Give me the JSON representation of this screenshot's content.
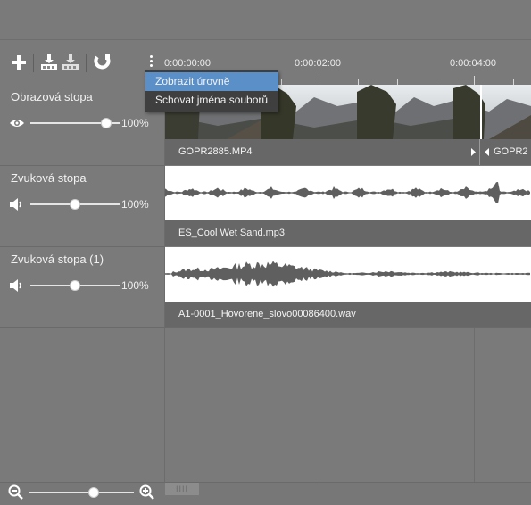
{
  "toolbar": {
    "buttons": [
      {
        "name": "add-track-button",
        "icon": "plus-icon"
      },
      {
        "name": "import-media-button",
        "icon": "import-icon"
      },
      {
        "name": "export-media-button",
        "icon": "export-icon"
      },
      {
        "name": "snap-button",
        "icon": "magnet-icon"
      },
      {
        "name": "more-options-button",
        "icon": "kebab-icon"
      }
    ]
  },
  "ruler": {
    "labels": [
      "0:00:00:00",
      "0:00:02:00",
      "0:00:04:00"
    ]
  },
  "tracks": [
    {
      "title": "Obrazová stopa",
      "icon": "eye-icon",
      "value": "100%",
      "level": 0.85,
      "clip": {
        "names": [
          "GOPR2885.MP4",
          "GOPR2"
        ],
        "kind": "video"
      }
    },
    {
      "title": "Zvuková stopa",
      "icon": "speaker-icon",
      "value": "100%",
      "level": 0.5,
      "clip": {
        "names": [
          "ES_Cool Wet Sand.mp3"
        ],
        "kind": "audio"
      }
    },
    {
      "title": "Zvuková stopa (1)",
      "icon": "speaker-icon",
      "value": "100%",
      "level": 0.5,
      "clip": {
        "names": [
          "A1-0001_Hovorene_slovo00086400.wav"
        ],
        "kind": "audio"
      }
    }
  ],
  "context_menu": {
    "items": [
      "Zobrazit úrovně",
      "Schovat jména souborů"
    ],
    "active_index": 0
  },
  "zoom": {
    "level": 0.62,
    "scroll_grip": "IIII"
  },
  "colors": {
    "accent": "#5a8fc8",
    "menu_bg": "#3f3f3f",
    "waveform": "#5f5f5f"
  }
}
